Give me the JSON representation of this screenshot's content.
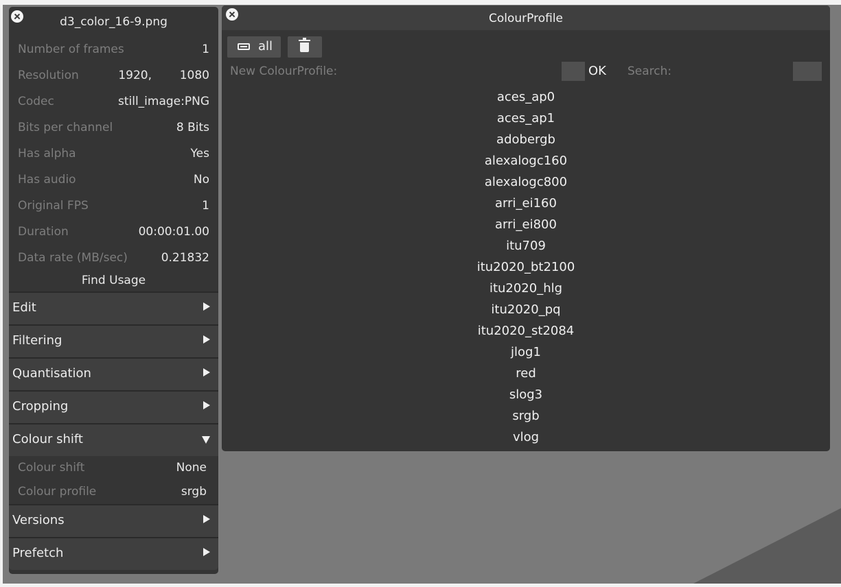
{
  "file_panel": {
    "title": "d3_color_16-9.png",
    "info": [
      {
        "label": "Number of frames",
        "value": "1"
      },
      {
        "label": "Resolution",
        "value1": "1920,",
        "value": "1080"
      },
      {
        "label": "Codec",
        "value": "still_image:PNG"
      },
      {
        "label": "Bits per channel",
        "value": "8 Bits"
      },
      {
        "label": "Has alpha",
        "value": "Yes"
      },
      {
        "label": "Has audio",
        "value": "No"
      },
      {
        "label": "Original FPS",
        "value": "1"
      },
      {
        "label": "Duration",
        "value": "00:00:01.00"
      },
      {
        "label": "Data rate (MB/sec)",
        "value": "0.21832"
      }
    ],
    "find_usage": "Find Usage",
    "sections": [
      "Edit",
      "Filtering",
      "Quantisation",
      "Cropping",
      "Colour shift",
      "Versions",
      "Prefetch"
    ],
    "colour_shift_rows": [
      {
        "label": "Colour shift",
        "value": "None"
      },
      {
        "label": "Colour profile",
        "value": "srgb"
      }
    ]
  },
  "colour_profile": {
    "title": "ColourProfile",
    "all_label": "all",
    "new_label": "New ColourProfile:",
    "ok_label": "OK",
    "search_label": "Search:",
    "profiles": [
      "aces_ap0",
      "aces_ap1",
      "adobergb",
      "alexalogc160",
      "alexalogc800",
      "arri_ei160",
      "arri_ei800",
      "itu709",
      "itu2020_bt2100",
      "itu2020_hlg",
      "itu2020_pq",
      "itu2020_st2084",
      "jlog1",
      "red",
      "slog3",
      "srgb",
      "vlog"
    ]
  }
}
